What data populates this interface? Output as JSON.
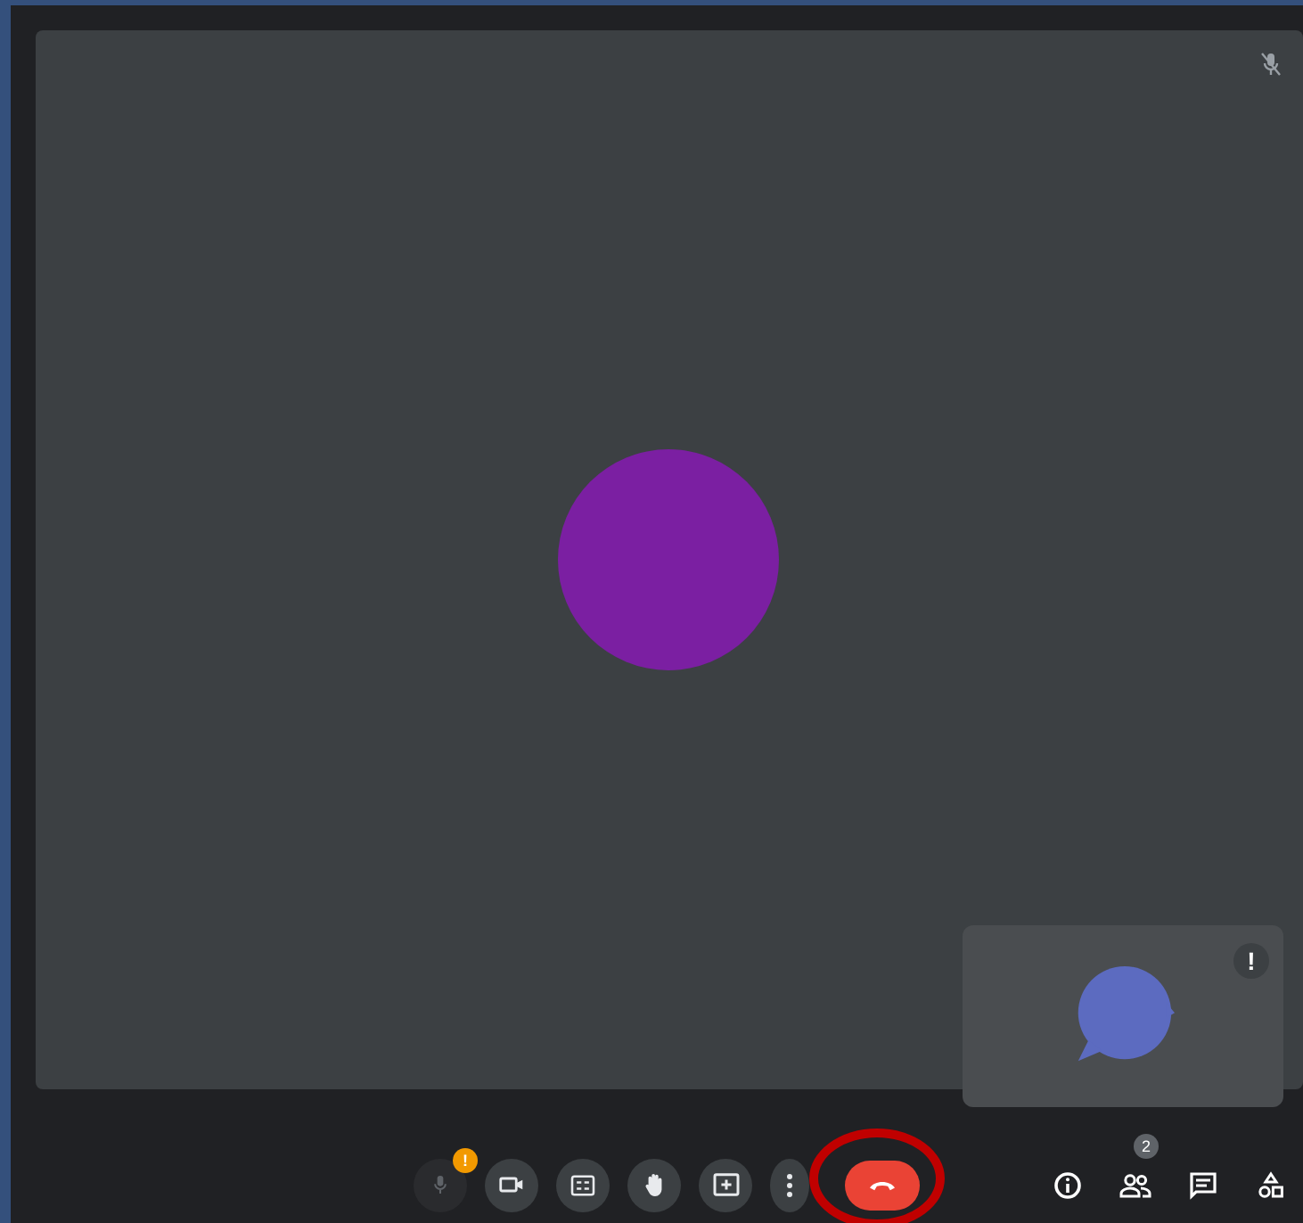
{
  "tiles": [
    {
      "kind": "main",
      "color": "#7b1fa2",
      "muted": true
    },
    {
      "kind": "self",
      "color": "#5c6bc0",
      "alert": "!"
    }
  ],
  "controls": [
    {
      "kind": "mic",
      "on": false,
      "badge": "!",
      "highlighted": false
    },
    {
      "kind": "camera",
      "on": true,
      "highlighted": false
    },
    {
      "kind": "captions",
      "on": true,
      "highlighted": false
    },
    {
      "kind": "hand",
      "on": true,
      "highlighted": false
    },
    {
      "kind": "present",
      "on": true,
      "highlighted": false
    },
    {
      "kind": "more",
      "on": true,
      "highlighted": false
    },
    {
      "kind": "hangup",
      "highlighted": true
    }
  ],
  "side_controls": [
    {
      "kind": "info"
    },
    {
      "kind": "people",
      "badge": "2"
    },
    {
      "kind": "chat"
    },
    {
      "kind": "activities"
    }
  ]
}
